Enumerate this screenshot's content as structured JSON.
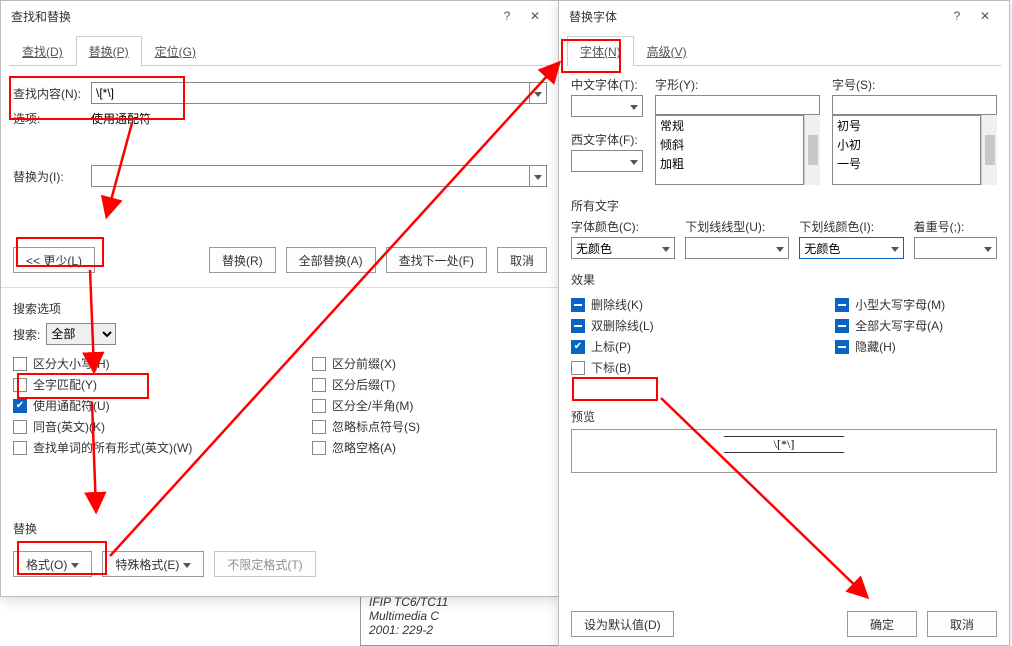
{
  "left": {
    "title": "查找和替换",
    "tabs": {
      "find": "查找(D)",
      "replace": "替换(P)",
      "goto": "定位(G)"
    },
    "findLabel": "查找内容(N):",
    "findValue": "\\[*\\]",
    "optionsLabel": "选项:",
    "optionsValue": "使用通配符",
    "replaceLabel": "替换为(I):",
    "replaceValue": "",
    "buttons": {
      "less": "<< 更少(L)",
      "replace": "替换(R)",
      "replaceAll": "全部替换(A)",
      "findNext": "查找下一处(F)",
      "cancel": "取消"
    },
    "searchOptionsTitle": "搜索选项",
    "searchLabel": "搜索:",
    "searchScope": "全部",
    "checks": {
      "matchCase": "区分大小写(H)",
      "wholeWord": "全字匹配(Y)",
      "wildcards": "使用通配符(U)",
      "soundsLike": "同音(英文)(K)",
      "wordForms": "查找单词的所有形式(英文)(W)",
      "prefix": "区分前缀(X)",
      "suffix": "区分后缀(T)",
      "halfFull": "区分全/半角(M)",
      "ignorePunct": "忽略标点符号(S)",
      "ignoreSpace": "忽略空格(A)"
    },
    "replaceSection": "替换",
    "formatBtn": "格式(O)",
    "specialBtn": "特殊格式(E)",
    "noFormatBtn": "不限定格式(T)"
  },
  "right": {
    "title": "替换字体",
    "tabs": {
      "font": "字体(N)",
      "adv": "高级(V)"
    },
    "chFontLabel": "中文字体(T):",
    "enFontLabel": "西文字体(F):",
    "styleLabel": "字形(Y):",
    "sizeLabel": "字号(S):",
    "styles": [
      "常规",
      "倾斜",
      "加粗"
    ],
    "sizes": [
      "初号",
      "小初",
      "一号"
    ],
    "allText": "所有文字",
    "fontColorLabel": "字体颜色(C):",
    "fontColorValue": "无颜色",
    "ulStyleLabel": "下划线线型(U):",
    "ulColorLabel": "下划线颜色(I):",
    "ulColorValue": "无颜色",
    "emphLabel": "着重号(;):",
    "effectsTitle": "效果",
    "effects": {
      "strike": "删除线(K)",
      "dstrike": "双删除线(L)",
      "super": "上标(P)",
      "sub": "下标(B)",
      "smallcaps": "小型大写字母(M)",
      "allcaps": "全部大写字母(A)",
      "hidden": "隐藏(H)"
    },
    "previewTitle": "预览",
    "previewText": "\\[*\\]",
    "setDefault": "设为默认值(D)",
    "ok": "确定",
    "cancel": "取消"
  },
  "underdoc": [
    "IFIP TC6/TC11",
    "Multimedia C",
    "2001: 229-2"
  ]
}
